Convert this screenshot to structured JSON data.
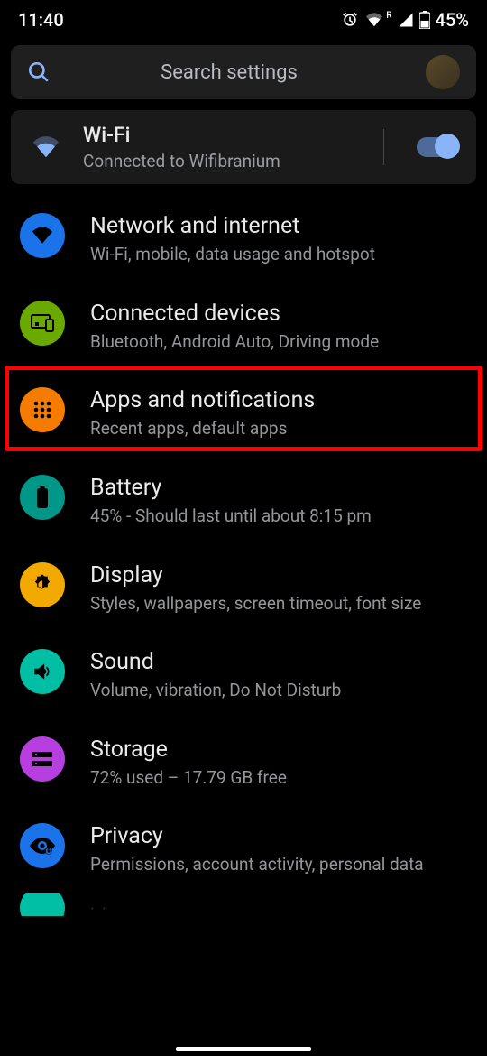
{
  "status": {
    "time": "11:40",
    "battery_text": "45%"
  },
  "search": {
    "placeholder": "Search settings"
  },
  "wifi_card": {
    "title": "Wi-Fi",
    "subtitle": "Connected to Wifibranium"
  },
  "items": [
    {
      "title": "Network and internet",
      "subtitle": "Wi-Fi, mobile, data usage and hotspot",
      "color": "#1a73e8"
    },
    {
      "title": "Connected devices",
      "subtitle": "Bluetooth, Android Auto, Driving mode",
      "color": "#6aaa00"
    },
    {
      "title": "Apps and notifications",
      "subtitle": "Recent apps, default apps",
      "color": "#f57c00"
    },
    {
      "title": "Battery",
      "subtitle": "45% - Should last until about 8:15 pm",
      "color": "#009688"
    },
    {
      "title": "Display",
      "subtitle": "Styles, wallpapers, screen timeout, font size",
      "color": "#f2a900"
    },
    {
      "title": "Sound",
      "subtitle": "Volume, vibration, Do Not Disturb",
      "color": "#00bfa5"
    },
    {
      "title": "Storage",
      "subtitle": "72% used – 17.79 GB free",
      "color": "#b73fe0"
    },
    {
      "title": "Privacy",
      "subtitle": "Permissions, account activity, personal data",
      "color": "#1a73e8"
    }
  ],
  "partial_item": {
    "title": "Location...",
    "color": "#00bfa5"
  },
  "highlight_index": 2
}
